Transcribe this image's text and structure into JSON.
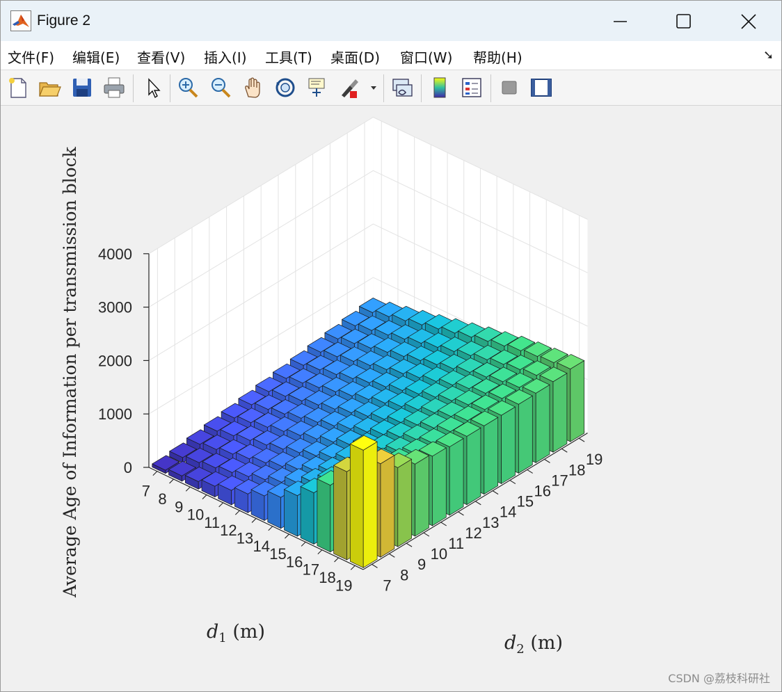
{
  "window": {
    "title": "Figure 2"
  },
  "menu": [
    {
      "label": "文件(F)"
    },
    {
      "label": "编辑(E)"
    },
    {
      "label": "查看(V)"
    },
    {
      "label": "插入(I)"
    },
    {
      "label": "工具(T)"
    },
    {
      "label": "桌面(D)"
    },
    {
      "label": "窗口(W)"
    },
    {
      "label": "帮助(H)"
    }
  ],
  "toolbar": [
    {
      "icon": "new-figure-icon"
    },
    {
      "icon": "open-file-icon"
    },
    {
      "icon": "save-icon"
    },
    {
      "icon": "print-icon"
    },
    {
      "icon": "pointer-icon"
    },
    {
      "icon": "zoom-in-icon"
    },
    {
      "icon": "zoom-out-icon"
    },
    {
      "icon": "pan-hand-icon"
    },
    {
      "icon": "rotate-3d-icon"
    },
    {
      "icon": "data-cursor-icon"
    },
    {
      "icon": "brush-icon"
    },
    {
      "icon": "link-plot-icon"
    },
    {
      "icon": "colorbar-icon"
    },
    {
      "icon": "legend-icon"
    },
    {
      "icon": "hide-plot-tools-icon"
    },
    {
      "icon": "show-plot-tools-icon"
    }
  ],
  "watermark": "CSDN @荔枝科研社",
  "chart_data": {
    "type": "bar3",
    "x_label": "d_2 (m)",
    "y_label": "d_1 (m)",
    "z_label": "Average Age of Information per transmission block",
    "d2_ticks": [
      7,
      8,
      9,
      10,
      11,
      12,
      13,
      14,
      15,
      16,
      17,
      18,
      19
    ],
    "d1_ticks": [
      7,
      8,
      9,
      10,
      11,
      12,
      13,
      14,
      15,
      16,
      17,
      18,
      19
    ],
    "z_ticks": [
      0,
      1000,
      2000,
      3000,
      4000
    ],
    "zlim": [
      0,
      4000
    ],
    "colormap": "parula",
    "values_approx": [
      [
        60,
        100,
        140,
        200,
        270,
        350,
        460,
        580,
        760,
        960,
        1250,
        1650,
        2200
      ],
      [
        100,
        150,
        200,
        260,
        330,
        420,
        520,
        650,
        800,
        980,
        1180,
        1450,
        1750
      ],
      [
        150,
        200,
        260,
        320,
        390,
        470,
        560,
        680,
        810,
        960,
        1110,
        1300,
        1480
      ],
      [
        200,
        260,
        320,
        380,
        450,
        530,
        620,
        730,
        840,
        960,
        1080,
        1220,
        1350
      ],
      [
        250,
        310,
        370,
        440,
        510,
        590,
        680,
        780,
        880,
        990,
        1090,
        1200,
        1300
      ],
      [
        300,
        360,
        420,
        490,
        560,
        640,
        730,
        820,
        920,
        1020,
        1120,
        1200,
        1280
      ],
      [
        350,
        410,
        470,
        540,
        610,
        690,
        770,
        860,
        950,
        1050,
        1140,
        1220,
        1280
      ],
      [
        400,
        460,
        520,
        590,
        660,
        740,
        820,
        900,
        990,
        1080,
        1160,
        1230,
        1280
      ],
      [
        450,
        510,
        570,
        640,
        710,
        780,
        860,
        940,
        1030,
        1110,
        1180,
        1240,
        1280
      ],
      [
        500,
        560,
        620,
        690,
        760,
        830,
        900,
        980,
        1060,
        1140,
        1200,
        1250,
        1290
      ],
      [
        550,
        610,
        670,
        740,
        810,
        880,
        950,
        1020,
        1100,
        1160,
        1220,
        1260,
        1300
      ],
      [
        600,
        660,
        720,
        790,
        860,
        930,
        1000,
        1070,
        1140,
        1200,
        1250,
        1290,
        1320
      ],
      [
        650,
        720,
        790,
        860,
        930,
        1000,
        1070,
        1140,
        1200,
        1260,
        1300,
        1330,
        1360
      ]
    ]
  }
}
